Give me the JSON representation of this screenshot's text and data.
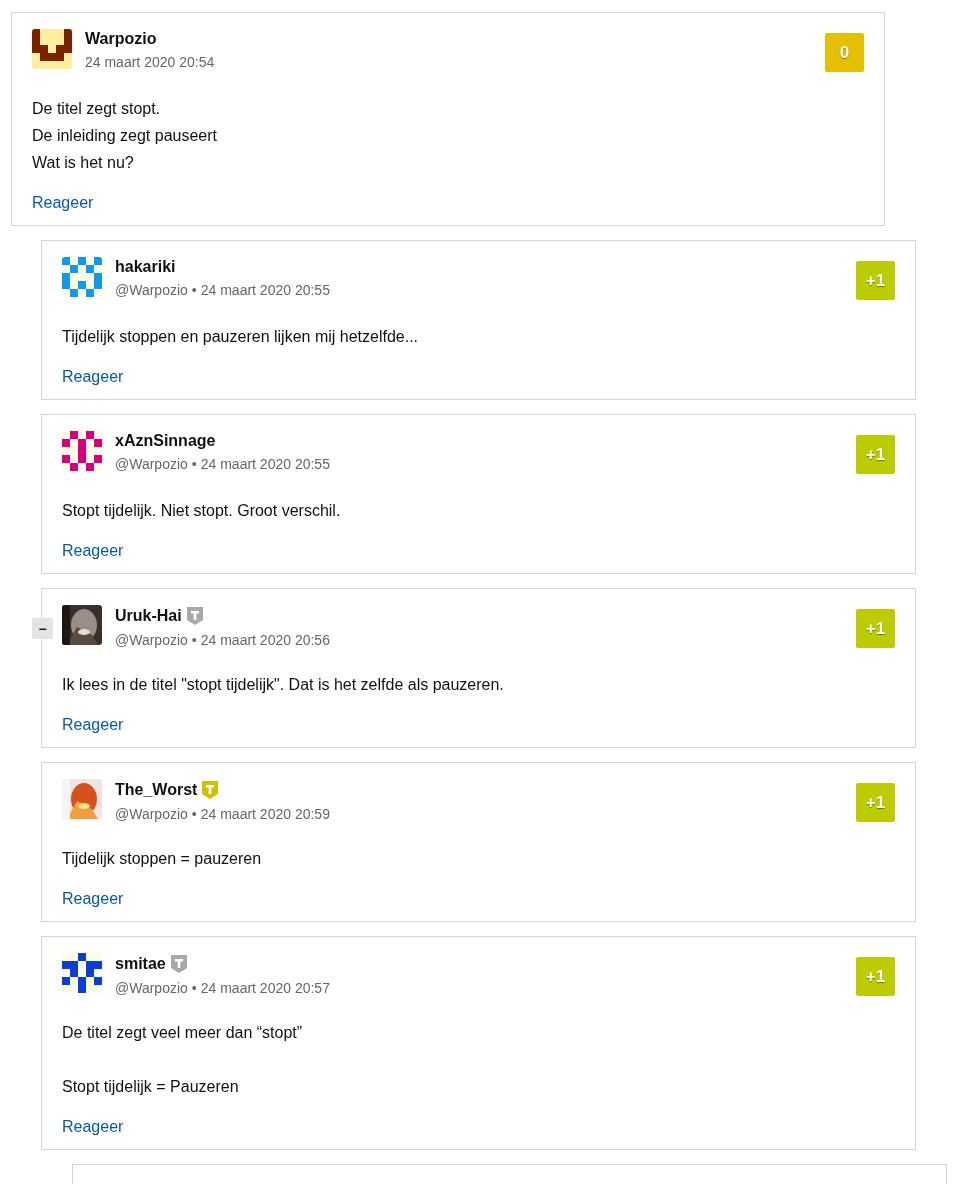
{
  "comment": {
    "author": "Warpozio",
    "avatar": {
      "kind": "identicon",
      "color": "#7a2100"
    },
    "date": "24 maart 2020 20:54",
    "score": {
      "text": "0",
      "color": "#e6bf00"
    },
    "paragraphs": [
      [
        "De titel zegt stopt.",
        "De inleiding zegt pauseert",
        "Wat is het nu?"
      ]
    ],
    "reply_link": "Reageer"
  },
  "replies": [
    {
      "author": "hakariki",
      "avatar": {
        "kind": "identicon",
        "color": "#0d9aee"
      },
      "mention": "@Warpozio",
      "separator": "•",
      "date": "24 maart 2020 20:55",
      "score": {
        "text": "+1",
        "color": "#bccc00"
      },
      "paragraphs": [
        [
          "Tijdelijk stoppen en pauzeren lijken mij hetzelfde..."
        ]
      ],
      "reply_link": "Reageer"
    },
    {
      "author": "xAznSinnage",
      "avatar": {
        "kind": "identicon",
        "color": "#d6007a"
      },
      "mention": "@Warpozio",
      "separator": "•",
      "date": "24 maart 2020 20:55",
      "score": {
        "text": "+1",
        "color": "#bccc00"
      },
      "paragraphs": [
        [
          "Stopt tijdelijk. Niet stopt. Groot verschil."
        ]
      ],
      "reply_link": "Reageer"
    },
    {
      "author": "Uruk-Hai",
      "badge": {
        "color": "#a8a8a8"
      },
      "collapse": "−",
      "avatar": {
        "kind": "picture"
      },
      "mention": "@Warpozio",
      "separator": "•",
      "date": "24 maart 2020 20:56",
      "score": {
        "text": "+1",
        "color": "#bccc00"
      },
      "paragraphs": [
        [
          "Ik lees in de titel \"stopt tijdelijk\". Dat is het zelfde als pauzeren."
        ]
      ],
      "reply_link": "Reageer"
    },
    {
      "author": "The_Worst",
      "badge": {
        "color": "#d2c000"
      },
      "avatar": {
        "kind": "picture"
      },
      "mention": "@Warpozio",
      "separator": "•",
      "date": "24 maart 2020 20:59",
      "score": {
        "text": "+1",
        "color": "#bccc00"
      },
      "paragraphs": [
        [
          "Tijdelijk stoppen = pauzeren"
        ]
      ],
      "reply_link": "Reageer"
    },
    {
      "author": "smitae",
      "badge": {
        "color": "#a8a8a8"
      },
      "avatar": {
        "kind": "identicon",
        "color": "#0a3fd6"
      },
      "mention": "@Warpozio",
      "separator": "•",
      "date": "24 maart 2020 20:57",
      "score": {
        "text": "+1",
        "color": "#bccc00"
      },
      "paragraphs": [
        [
          "De titel zegt veel meer dan “stopt”"
        ],
        [
          "Stopt tijdelijk = Pauzeren"
        ]
      ],
      "reply_link": "Reageer"
    }
  ]
}
